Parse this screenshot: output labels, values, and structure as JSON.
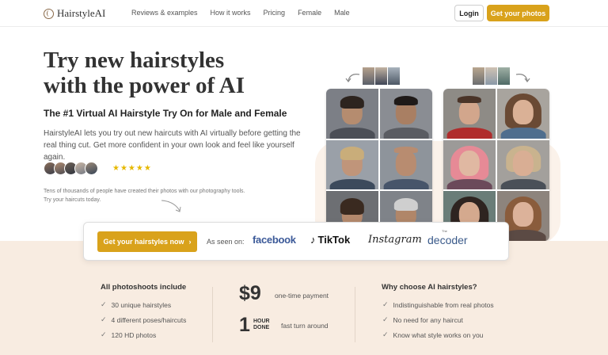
{
  "nav": {
    "logo": "HairstyleAI",
    "links": [
      "Reviews & examples",
      "How it works",
      "Pricing",
      "Female",
      "Male"
    ],
    "login": "Login",
    "cta": "Get your photos"
  },
  "hero": {
    "title_line1": "Try new hairstyles",
    "title_line2": "with the power of AI",
    "subtitle": "The #1 Virtual AI Hairstyle Try On for Male and Female",
    "description": "HairstyleAI lets you try out new haircuts with AI virtually before getting the real thing cut. Get more confident in your own look and feel like yourself again.",
    "stars": "★★★★★",
    "social_line1": "Tens of thousands of people have created their photos with our photography tools.",
    "social_line2": "Try your haircuts today."
  },
  "card": {
    "button": "Get your hairstyles now",
    "button_icon": "›",
    "seen_on": "As seen on:",
    "brands": {
      "facebook": "facebook",
      "tiktok": "TikTok",
      "tiktok_icon": "♪",
      "instagram": "Instagram",
      "decoder": "decoder",
      "decoder_small": "The"
    }
  },
  "includes": {
    "title": "All photoshoots include",
    "items": [
      "30 unique hairstyles",
      "4 different poses/haircuts",
      "120 HD photos"
    ]
  },
  "pricing": {
    "price": "$9",
    "price_note": "one-time payment",
    "time_value": "1",
    "time_unit_line1": "HOUR",
    "time_unit_line2": "DONE",
    "time_note": "fast turn around"
  },
  "why": {
    "title": "Why choose AI hairstyles?",
    "items": [
      "Indistinguishable from real photos",
      "No need for any haircut",
      "Know what style works on you"
    ]
  },
  "colors": {
    "accent": "#d9a21b",
    "peach_bg": "#f8ece1",
    "text": "#333333"
  }
}
